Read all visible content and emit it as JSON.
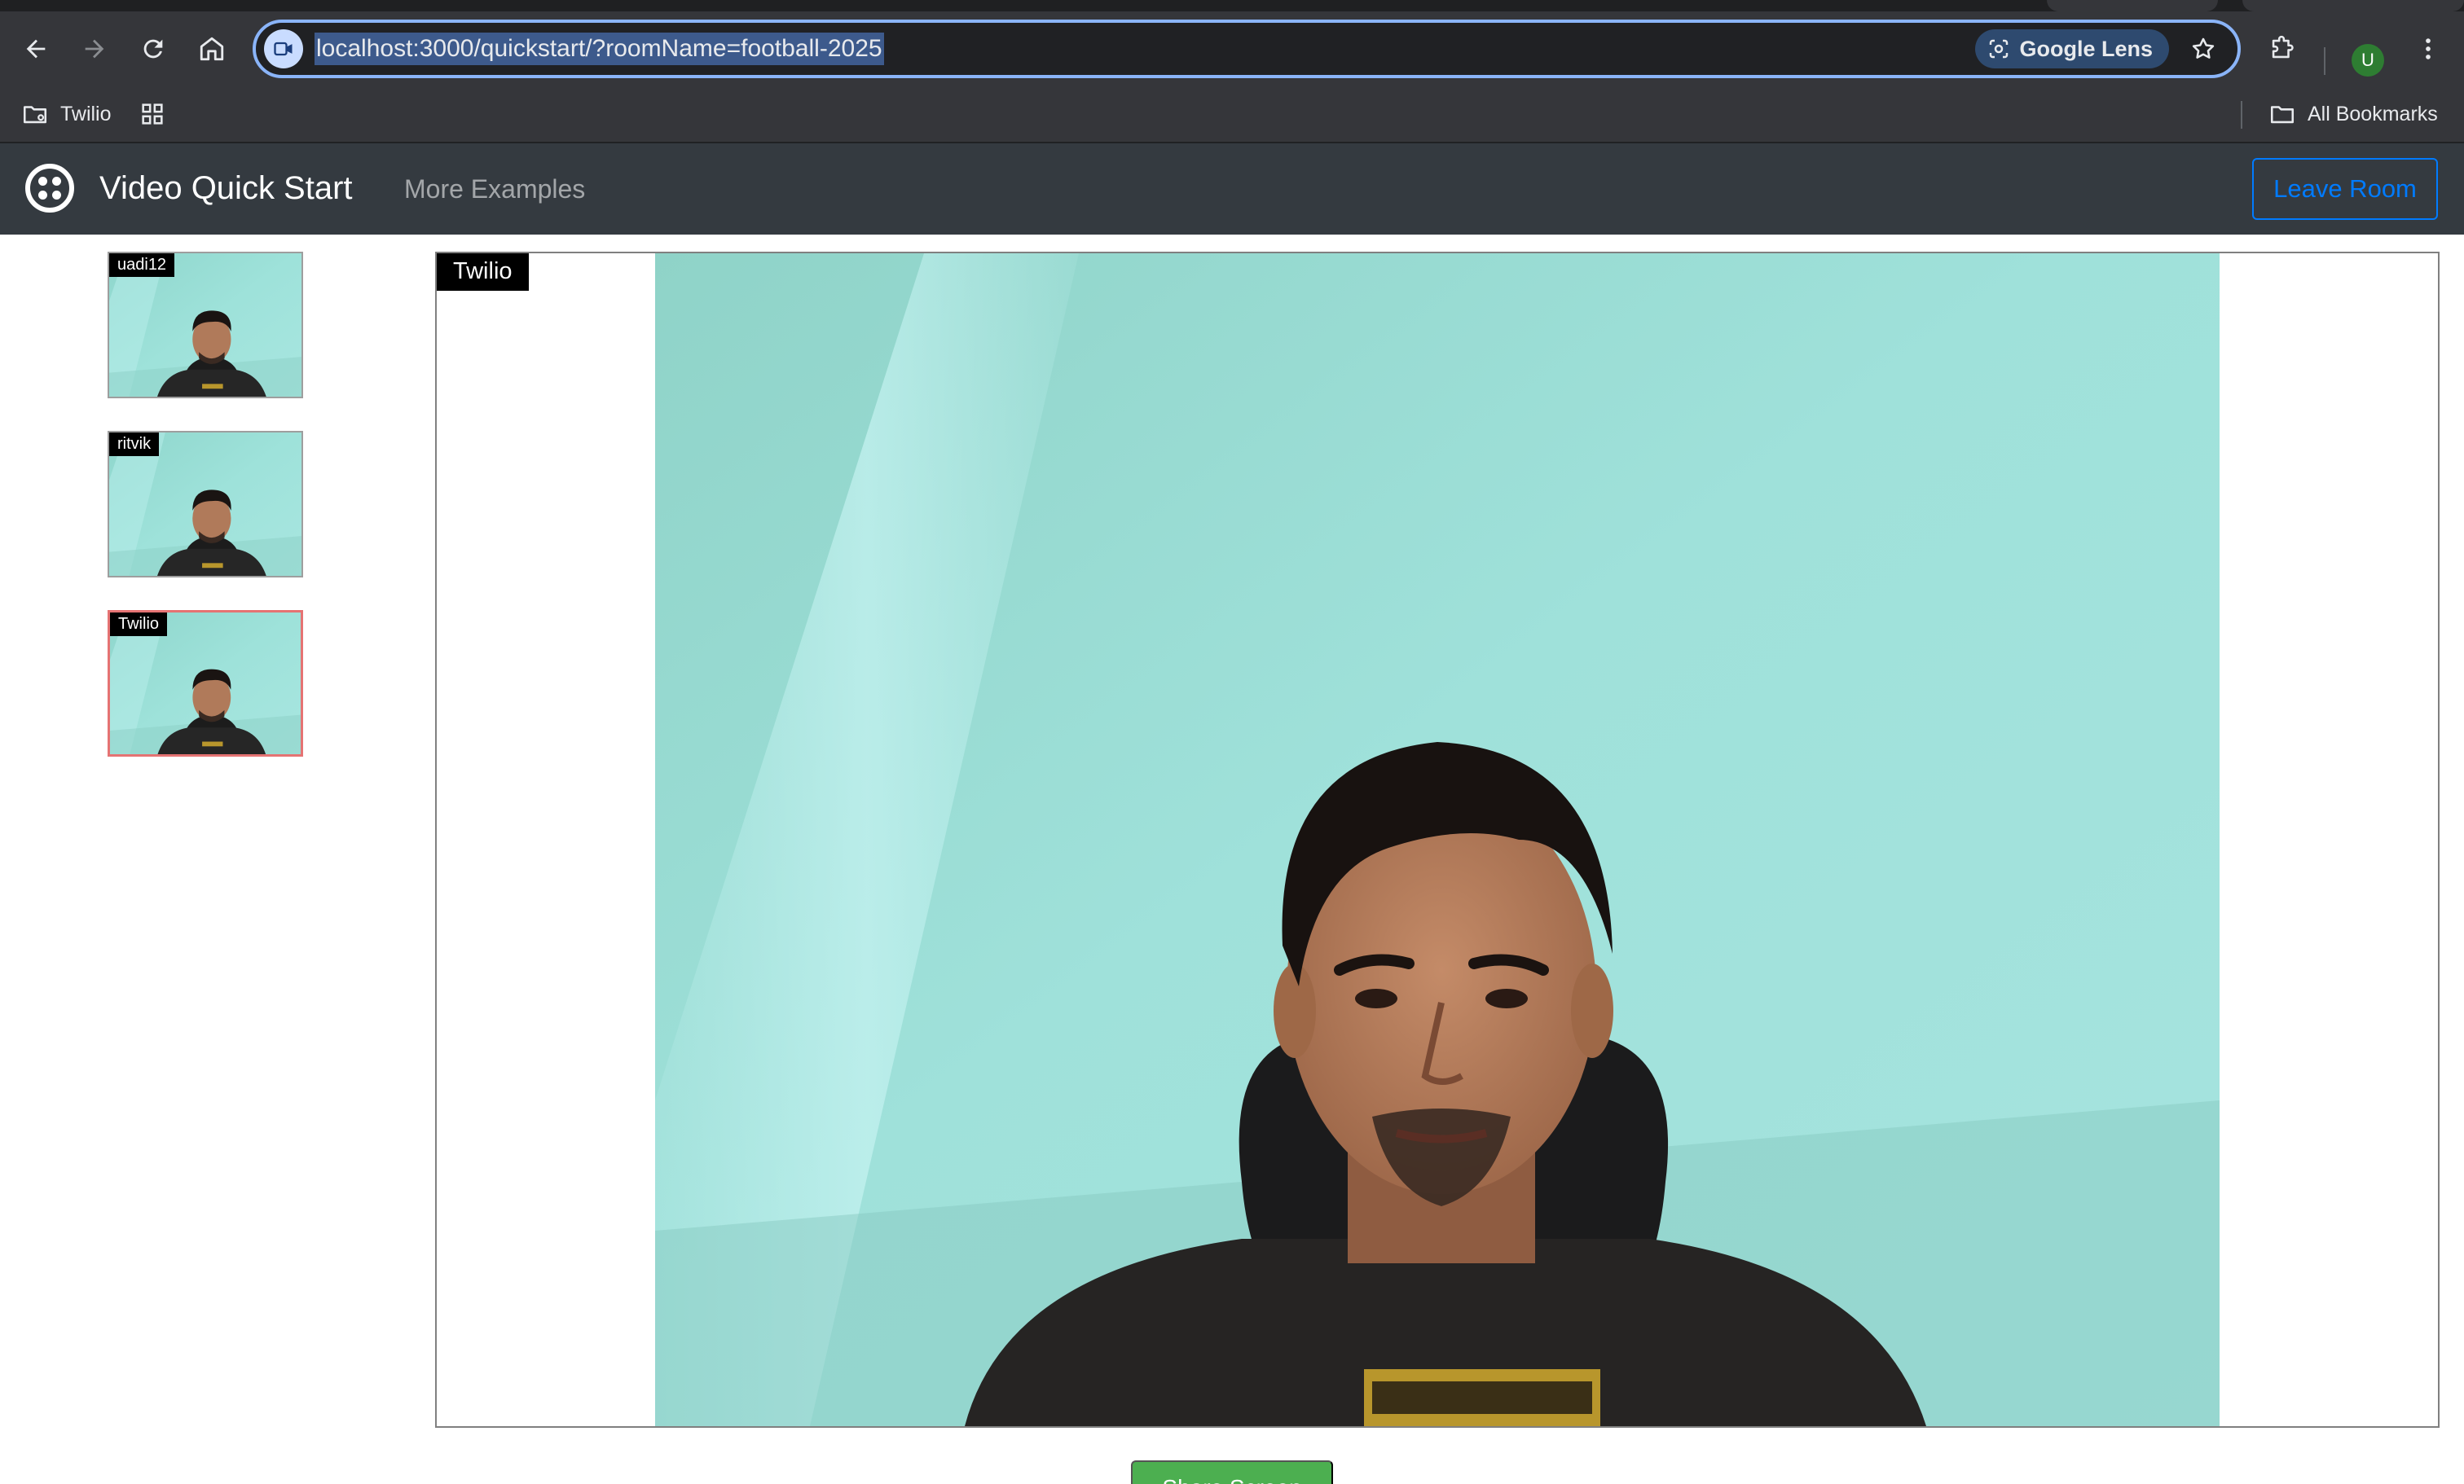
{
  "browser": {
    "url": "localhost:3000/quickstart/?roomName=football-2025",
    "lens_label": "Google Lens",
    "profile_initial": "U",
    "bookmarks": {
      "folder_label": "Twilio",
      "all_bookmarks_label": "All Bookmarks"
    }
  },
  "navbar": {
    "title": "Video Quick Start",
    "more_examples_label": "More Examples",
    "leave_room_label": "Leave Room"
  },
  "participants": [
    {
      "name": "uadi12",
      "active": false
    },
    {
      "name": "ritvik",
      "active": false
    },
    {
      "name": "Twilio",
      "active": true
    }
  ],
  "main_video": {
    "participant_name": "Twilio"
  },
  "actions": {
    "share_screen_label": "Share Screen"
  },
  "colors": {
    "navbar_bg": "#343a40",
    "leave_room_accent": "#007bff",
    "active_border": "#e57373",
    "share_button": "#4caf50",
    "omnibox_focus": "#8ab4f8"
  }
}
